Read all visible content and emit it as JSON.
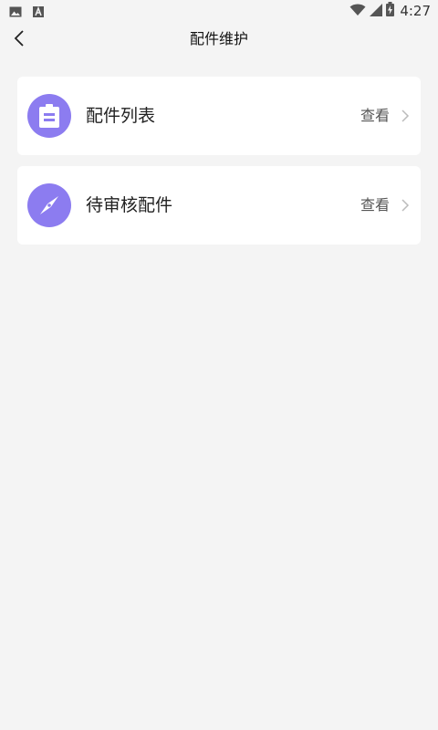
{
  "status_bar": {
    "time": "4:27",
    "left_icons": [
      "image-icon",
      "font-a-icon"
    ],
    "right_icons": [
      "wifi-icon",
      "cellular-signal-icon",
      "battery-charging-icon"
    ]
  },
  "navbar": {
    "back_icon": "chevron-left-icon",
    "title": "配件维护"
  },
  "items": [
    {
      "label": "配件列表",
      "action": "查看",
      "icon": "clipboard-icon"
    },
    {
      "label": "待审核配件",
      "action": "查看",
      "icon": "compass-icon"
    }
  ],
  "colors": {
    "accent": "#8c7cf0",
    "background": "#f4f4f4",
    "card": "#ffffff"
  }
}
